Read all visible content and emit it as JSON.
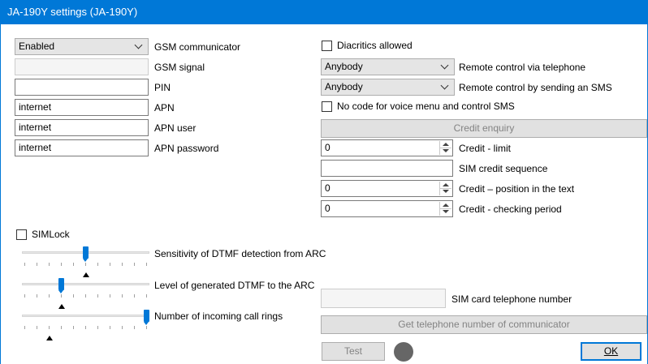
{
  "window": {
    "title": "JA-190Y settings (JA-190Y)"
  },
  "left": {
    "gsm_communicator": {
      "value": "Enabled",
      "label": "GSM communicator"
    },
    "gsm_signal": {
      "value": "",
      "label": "GSM signal"
    },
    "pin": {
      "value": "",
      "label": "PIN"
    },
    "apn": {
      "value": "internet",
      "label": "APN"
    },
    "apn_user": {
      "value": "internet",
      "label": "APN user"
    },
    "apn_password": {
      "value": "internet",
      "label": "APN password"
    },
    "simlock": {
      "label": "SIMLock",
      "checked": false
    },
    "sliders": [
      {
        "label": "Sensitivity of DTMF detection from ARC",
        "level": 0.5,
        "default": 0.5
      },
      {
        "label": "Level of generated DTMF to the ARC",
        "level": 0.3,
        "default": 0.3
      },
      {
        "label": "Number of incoming call rings",
        "level": 1.0,
        "default": 0.2
      }
    ]
  },
  "right": {
    "diacritics": {
      "label": "Diacritics allowed",
      "checked": false
    },
    "remote_tel": {
      "value": "Anybody",
      "label": "Remote control via telephone"
    },
    "remote_sms": {
      "value": "Anybody",
      "label": "Remote control by sending an SMS"
    },
    "no_code": {
      "label": "No code for voice menu and control SMS",
      "checked": false
    },
    "credit_enquiry": "Credit enquiry",
    "credit_limit": {
      "value": "0",
      "label": "Credit - limit"
    },
    "sim_credit_sequence": {
      "value": "",
      "label": "SIM credit sequence"
    },
    "credit_position": {
      "value": "0",
      "label": "Credit – position in the text"
    },
    "credit_period": {
      "value": "0",
      "label": "Credit - checking period"
    },
    "sim_phone": {
      "value": "",
      "label": "SIM card telephone number"
    },
    "get_phone_button": "Get telephone number of communicator"
  },
  "footer": {
    "test_button": "Test",
    "ok_button": "OK"
  },
  "colors": {
    "accent": "#0078d7",
    "led": "#666666",
    "disabled_text": "#838383"
  }
}
